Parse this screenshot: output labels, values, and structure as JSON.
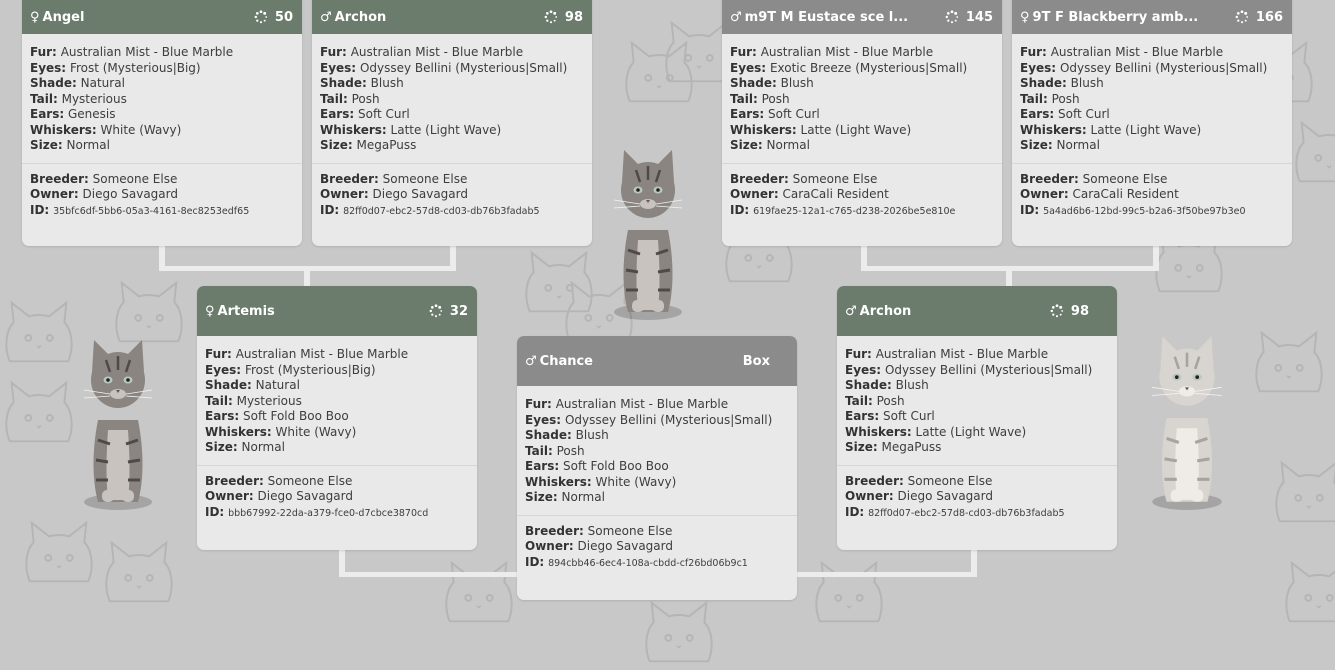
{
  "colors": {
    "header_green": "#6b7b6c",
    "header_grey": "#8b8b8b",
    "card_bg": "#e9e9e9",
    "background": "#c8c8c8"
  },
  "icons": {
    "female": "female-symbol-icon",
    "male": "male-symbol-icon",
    "generation": "generation-spinner-icon"
  },
  "labels": {
    "fur": "Fur:",
    "eyes": "Eyes:",
    "shade": "Shade:",
    "tail": "Tail:",
    "ears": "Ears:",
    "whiskers": "Whiskers:",
    "size": "Size:",
    "breeder": "Breeder:",
    "owner": "Owner:",
    "id": "ID:"
  },
  "cards": {
    "angel": {
      "symbol": "♀",
      "name": "Angel",
      "badge": "50",
      "fur": "Australian Mist - Blue Marble",
      "eyes": "Frost (Mysterious|Big)",
      "shade": "Natural",
      "tail": "Mysterious",
      "ears": "Genesis",
      "whiskers": "White (Wavy)",
      "size": "Normal",
      "breeder": "Someone Else",
      "owner": "Diego Savagard",
      "id": "35bfc6df-5bb6-05a3-4161-8ec8253edf65"
    },
    "archon_top": {
      "symbol": "♂",
      "name": "Archon",
      "badge": "98",
      "fur": "Australian Mist - Blue Marble",
      "eyes": "Odyssey Bellini (Mysterious|Small)",
      "shade": "Blush",
      "tail": "Posh",
      "ears": "Soft Curl",
      "whiskers": "Latte (Light Wave)",
      "size": "MegaPuss",
      "breeder": "Someone Else",
      "owner": "Diego Savagard",
      "id": "82ff0d07-ebc2-57d8-cd03-db76b3fadab5"
    },
    "eustace": {
      "symbol": "♂",
      "name": "m9T M Eustace sce l...",
      "badge": "145",
      "fur": "Australian Mist - Blue Marble",
      "eyes": "Exotic Breeze (Mysterious|Small)",
      "shade": "Blush",
      "tail": "Posh",
      "ears": "Soft Curl",
      "whiskers": "Latte (Light Wave)",
      "size": "Normal",
      "breeder": "Someone Else",
      "owner": "CaraCali Resident",
      "id": "619fae25-12a1-c765-d238-2026be5e810e"
    },
    "blackberry": {
      "symbol": "♀",
      "name": "9T F Blackberry amb...",
      "badge": "166",
      "fur": "Australian Mist - Blue Marble",
      "eyes": "Odyssey Bellini (Mysterious|Small)",
      "shade": "Blush",
      "tail": "Posh",
      "ears": "Soft Curl",
      "whiskers": "Latte (Light Wave)",
      "size": "Normal",
      "breeder": "Someone Else",
      "owner": "CaraCali Resident",
      "id": "5a4ad6b6-12bd-99c5-b2a6-3f50be97b3e0"
    },
    "artemis": {
      "symbol": "♀",
      "name": "Artemis",
      "badge": "32",
      "fur": "Australian Mist - Blue Marble",
      "eyes": "Frost (Mysterious|Big)",
      "shade": "Natural",
      "tail": "Mysterious",
      "ears": "Soft Fold Boo Boo",
      "whiskers": "White (Wavy)",
      "size": "Normal",
      "breeder": "Someone Else",
      "owner": "Diego Savagard",
      "id": "bbb67992-22da-a379-fce0-d7cbce3870cd"
    },
    "chance": {
      "symbol": "♂",
      "name": "Chance",
      "badge": "Box",
      "fur": "Australian Mist - Blue Marble",
      "eyes": "Odyssey Bellini (Mysterious|Small)",
      "shade": "Blush",
      "tail": "Posh",
      "ears": "Soft Fold Boo Boo",
      "whiskers": "White (Wavy)",
      "size": "Normal",
      "breeder": "Someone Else",
      "owner": "Diego Savagard",
      "id": "894cbb46-6ec4-108a-cbdd-cf26bd06b9c1"
    },
    "archon_mid": {
      "symbol": "♂",
      "name": "Archon",
      "badge": "98",
      "fur": "Australian Mist - Blue Marble",
      "eyes": "Odyssey Bellini (Mysterious|Small)",
      "shade": "Blush",
      "tail": "Posh",
      "ears": "Soft Curl",
      "whiskers": "Latte (Light Wave)",
      "size": "MegaPuss",
      "breeder": "Someone Else",
      "owner": "Diego Savagard",
      "id": "82ff0d07-ebc2-57d8-cd03-db76b3fadab5"
    }
  }
}
